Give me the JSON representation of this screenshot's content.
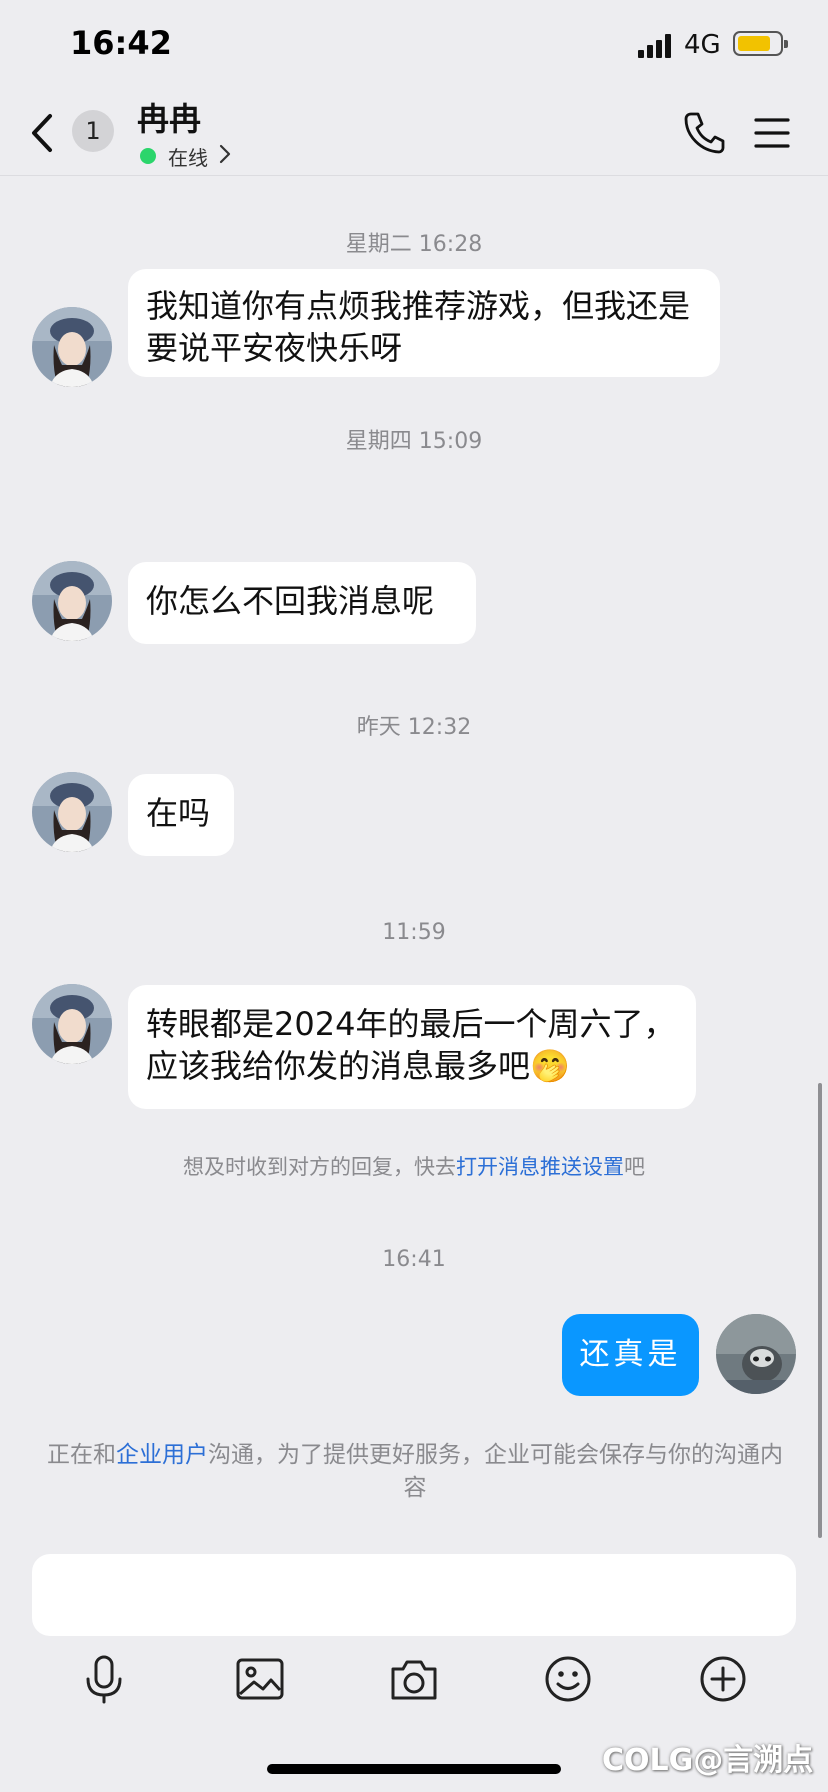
{
  "status_bar": {
    "time": "16:42",
    "network": "4G",
    "battery_level": 0.75,
    "battery_color": "#f2c200"
  },
  "header": {
    "back_label": "back",
    "unread_count": "1",
    "contact_name": "冉冉",
    "status_text": "在线"
  },
  "chat": {
    "messages": [
      {
        "type": "timestamp",
        "text": "星期二 16:28"
      },
      {
        "type": "incoming",
        "text": "我知道你有点烦我推荐游戏，但我还是要说平安夜快乐呀"
      },
      {
        "type": "timestamp",
        "text": "星期四 15:09"
      },
      {
        "type": "incoming",
        "text": "你怎么不回我消息呢"
      },
      {
        "type": "timestamp",
        "text": "昨天 12:32"
      },
      {
        "type": "incoming",
        "text": "在吗"
      },
      {
        "type": "timestamp",
        "text": "11:59"
      },
      {
        "type": "incoming",
        "text": "转眼都是2024年的最后一个周六了，应该我给你发的消息最多吧",
        "emoji": "🤭"
      },
      {
        "type": "notice",
        "text_before": "想及时收到对方的回复，快去",
        "link_text": "打开消息推送设置",
        "text_after": "吧"
      },
      {
        "type": "timestamp",
        "text": "16:41"
      },
      {
        "type": "outgoing",
        "text": "还真是"
      }
    ],
    "footer": {
      "text_before": "正在和",
      "link_text": "企业用户",
      "text_after": "沟通，为了提供更好服务，企业可能会保存与你的沟通内容"
    },
    "accent_color": "#0a97ff",
    "link_color": "#2c6fd6"
  },
  "input": {
    "placeholder": ""
  },
  "toolbar": {
    "items": [
      "microphone-icon",
      "image-icon",
      "camera-icon",
      "emoji-icon",
      "plus-icon"
    ]
  },
  "watermark": "COLG@言溯点"
}
